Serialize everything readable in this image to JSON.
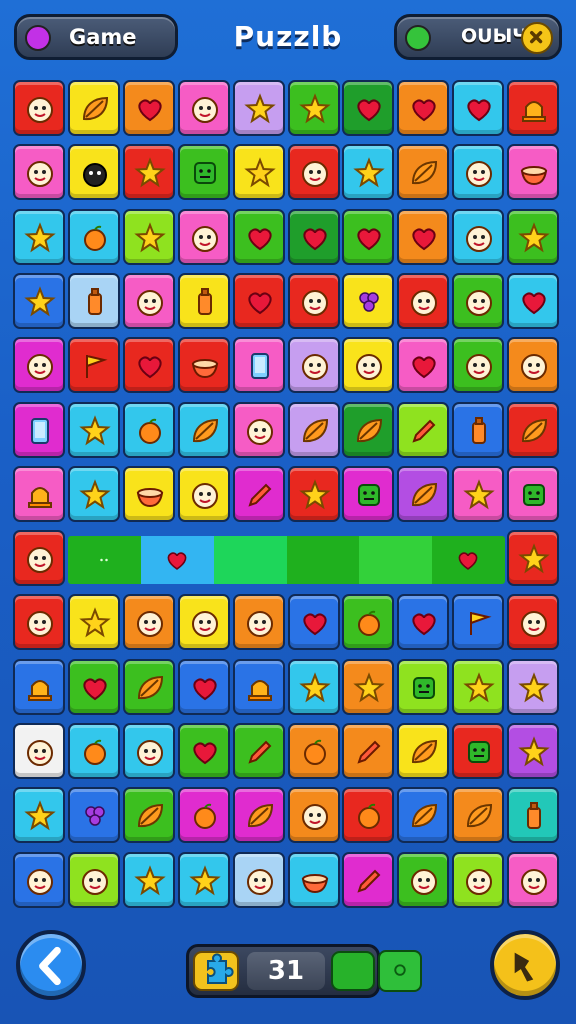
{
  "header": {
    "mode_label": "Game",
    "title": "Puzzlb",
    "score_label": "OUЫЧ",
    "mode_dot_color": "#c231e6",
    "score_dot_color": "#35c33b",
    "close_icon": "close-icon"
  },
  "colors": {
    "red": "#e8281f",
    "orange": "#f48a1c",
    "yellow": "#f9e31b",
    "green": "#3cbf1f",
    "dkgreen": "#1f9e2b",
    "cyan": "#33c7ec",
    "blue": "#2a73e6",
    "pink": "#f65cc5",
    "magenta": "#e02ccf",
    "purple": "#b34ee3",
    "lilac": "#c69ef0",
    "lime": "#8fe21f",
    "white": "#f2f2f2",
    "ltblue": "#a9d4f5",
    "teal": "#22c8b8"
  },
  "board": {
    "rows": [
      [
        "red:face",
        "yellow:leaf",
        "orange:heart",
        "pink:face",
        "lilac:star",
        "green:star",
        "dkgreen:heart",
        "orange:heart",
        "cyan:heart",
        "red:bell"
      ],
      [
        "pink:face",
        "yellow:bomb",
        "red:star",
        "green:square",
        "yellow:star",
        "red:face",
        "cyan:star",
        "orange:leaf",
        "cyan:face",
        "pink:bowl"
      ],
      [
        "cyan:star",
        "cyan:fruit",
        "lime:star",
        "pink:face",
        "green:heart",
        "dkgreen:heart",
        "green:heart",
        "orange:heart",
        "cyan:face",
        "green:star"
      ],
      [
        "blue:star",
        "ltblue:bottle",
        "pink:face",
        "yellow:bottle",
        "red:heart",
        "red:face",
        "yellow:grape",
        "red:face",
        "green:face",
        "cyan:heart"
      ],
      [
        "magenta:face",
        "red:flag",
        "red:heart",
        "red:bowl",
        "pink:phone",
        "lilac:face",
        "yellow:face",
        "pink:heart",
        "green:face",
        "orange:face"
      ],
      [
        "magenta:phone",
        "cyan:star",
        "cyan:fruit",
        "cyan:leaf",
        "pink:face",
        "lilac:leaf",
        "dkgreen:leaf",
        "lime:pencil",
        "blue:bottle",
        "red:leaf"
      ],
      [
        "pink:bell",
        "cyan:star",
        "yellow:bowl",
        "yellow:face",
        "magenta:pencil",
        "red:star",
        "magenta:square",
        "purple:leaf",
        "pink:star",
        "pink:square"
      ],
      [
        "red:face",
        "",
        "",
        "",
        "",
        "",
        "",
        "",
        "",
        "red:star"
      ],
      [
        "red:face",
        "yellow:star",
        "orange:face",
        "yellow:face",
        "orange:face",
        "blue:heart",
        "green:fruit",
        "blue:heart",
        "blue:flag",
        "red:face"
      ],
      [
        "blue:bell",
        "green:heart",
        "green:leaf",
        "blue:heart",
        "blue:bell",
        "cyan:star",
        "orange:star",
        "lime:square",
        "lime:star",
        "lilac:star"
      ],
      [
        "white:face",
        "cyan:fruit",
        "cyan:face",
        "green:heart",
        "green:pencil",
        "orange:fruit",
        "orange:pencil",
        "yellow:leaf",
        "red:square",
        "purple:star"
      ],
      [
        "cyan:star",
        "blue:grape",
        "green:leaf",
        "magenta:fruit",
        "magenta:leaf",
        "orange:face",
        "red:fruit",
        "blue:leaf",
        "orange:leaf",
        "teal:bottle"
      ],
      [
        "blue:face",
        "lime:face",
        "cyan:star",
        "cyan:star",
        "ltblue:face",
        "cyan:bowl",
        "magenta:pencil",
        "green:face",
        "lime:face",
        "pink:face"
      ]
    ],
    "stripe": [
      {
        "color": "#1fb01e",
        "icon": "dots-icon"
      },
      {
        "color": "#33b5f2",
        "icon": "heart-icon"
      },
      {
        "color": "#1ed65a"
      },
      {
        "color": "#1fb01e"
      },
      {
        "color": "#33d13a"
      },
      {
        "color": "#1fb01e",
        "icon": "heart-icon"
      }
    ]
  },
  "footer": {
    "back_icon": "chevron-left-icon",
    "moves_icon": "puzzle-piece-icon",
    "moves_count": "31",
    "next_icon": "hammer-icon"
  }
}
